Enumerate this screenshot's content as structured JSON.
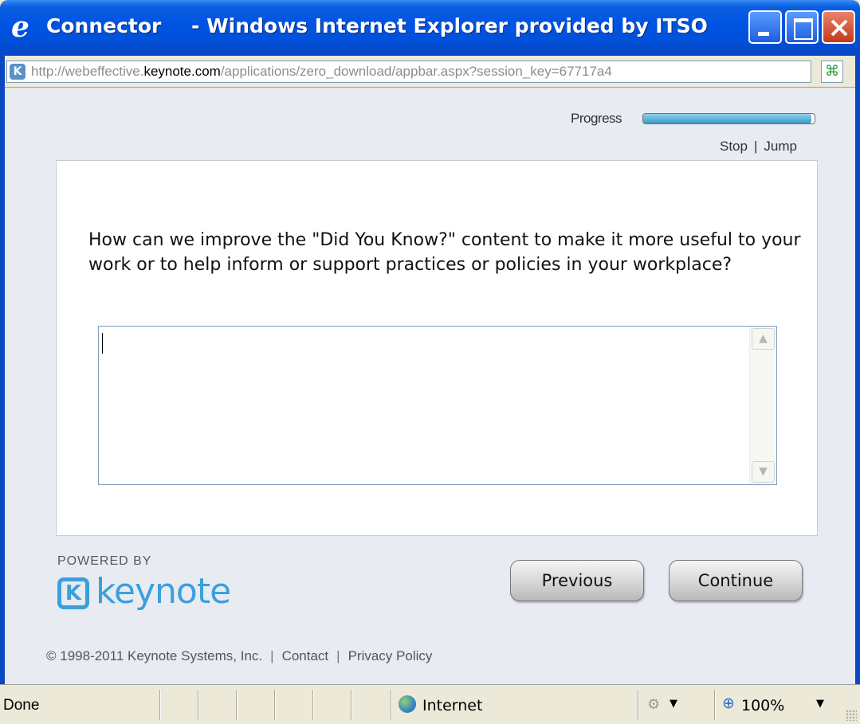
{
  "window": {
    "title_app": "Connector",
    "title_rest": "- Windows Internet Explorer provided by ITSO"
  },
  "address_bar": {
    "url_prefix": "http://webeffective.",
    "url_domain": "keynote.com",
    "url_suffix": "/applications/zero_download/appbar.aspx?session_key=67717a4"
  },
  "survey": {
    "progress_label": "Progress",
    "progress_fraction": 0.98,
    "stop_label": "Stop",
    "separator": "|",
    "jump_label": "Jump",
    "question": "How can we improve the \"Did You Know?\" content to make it more useful to your work or to help inform or support practices or policies in your workplace?",
    "answer_value": ""
  },
  "footer": {
    "powered_by": "POWERED BY",
    "logo_text": "keynote",
    "previous_label": "Previous",
    "continue_label": "Continue",
    "copyright": "© 1998-2011 Keynote Systems, Inc.",
    "contact_label": "Contact",
    "privacy_label": "Privacy Policy",
    "separator": "|"
  },
  "status_bar": {
    "status_text": "Done",
    "zone_label": "Internet",
    "zoom_label": "100%"
  },
  "icons": {
    "ie_logo": "ie-logo-icon",
    "site": "keynote-site-icon",
    "compat": "compatibility-view-icon",
    "zone": "internet-globe-icon",
    "zoom": "zoom-icon"
  },
  "colors": {
    "titlebar": "#0054e3",
    "brand": "#3aa0dc",
    "progress_fill": "#3a9ac8"
  }
}
